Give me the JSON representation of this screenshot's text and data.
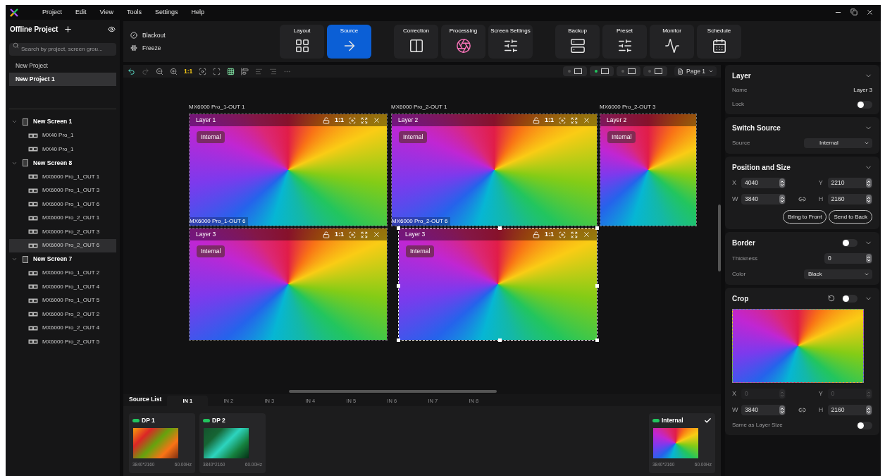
{
  "menu": [
    "Project",
    "Edit",
    "View",
    "Tools",
    "Settings",
    "Help"
  ],
  "sidebar": {
    "title": "Offline Project",
    "search": {
      "placeholder": "Search by project, screen grou..."
    },
    "projects": [
      {
        "label": "New Project",
        "selected": false
      },
      {
        "label": "New Project 1",
        "selected": true
      }
    ],
    "screens": [
      {
        "label": "New Screen 1",
        "expanded": true,
        "children": [
          {
            "label": "MX40 Pro_1",
            "selected": false
          },
          {
            "label": "MX40 Pro_1",
            "selected": false
          }
        ]
      },
      {
        "label": "New Screen 8",
        "expanded": true,
        "children": [
          {
            "label": "MX6000 Pro_1_OUT 1",
            "selected": false
          },
          {
            "label": "MX6000 Pro_1_OUT 3",
            "selected": false
          },
          {
            "label": "MX6000 Pro_1_OUT 6",
            "selected": false
          },
          {
            "label": "MX6000 Pro_2_OUT 1",
            "selected": false
          },
          {
            "label": "MX6000 Pro_2_OUT 3",
            "selected": false
          },
          {
            "label": "MX6000 Pro_2_OUT 6",
            "selected": true
          }
        ]
      },
      {
        "label": "New Screen 7",
        "expanded": true,
        "children": [
          {
            "label": "MX6000 Pro_1_OUT 2",
            "selected": false
          },
          {
            "label": "MX6000 Pro_1_OUT 4",
            "selected": false
          },
          {
            "label": "MX6000 Pro_1_OUT 5",
            "selected": false
          },
          {
            "label": "MX6000 Pro_2_OUT 2",
            "selected": false
          },
          {
            "label": "MX6000 Pro_2_OUT 4",
            "selected": false
          },
          {
            "label": "MX6000 Pro_2_OUT 5",
            "selected": false
          }
        ]
      }
    ]
  },
  "quick_actions": [
    {
      "kind": "blackout",
      "label": "Blackout"
    },
    {
      "kind": "freeze",
      "label": "Freeze"
    }
  ],
  "function_groups": [
    [
      {
        "kind": "layout",
        "label": "Layout",
        "selected": false
      },
      {
        "kind": "source",
        "label": "Source",
        "selected": true
      }
    ],
    [
      {
        "kind": "correction",
        "label": "Correction",
        "selected": false
      },
      {
        "kind": "processing",
        "label": "Processing",
        "selected": false
      },
      {
        "kind": "screen_settings",
        "label": "Screen Settings",
        "selected": false
      }
    ],
    [
      {
        "kind": "backup",
        "label": "Backup",
        "selected": false
      },
      {
        "kind": "preset",
        "label": "Preset",
        "selected": false
      },
      {
        "kind": "monitor",
        "label": "Monitor",
        "selected": false
      },
      {
        "kind": "schedule",
        "label": "Schedule",
        "selected": false
      }
    ]
  ],
  "canvas_toolbar": {
    "zoom_label": "1:1",
    "modes": [
      {
        "on": false
      },
      {
        "on": true
      },
      {
        "on": false
      },
      {
        "on": false
      }
    ],
    "page": "Page 1"
  },
  "canvas": {
    "screen_labels": [
      "MX6000 Pro_1-OUT 1",
      "MX6000 Pro_2-OUT 1",
      "MX6000 Pro_2-OUT 3"
    ],
    "layers": [
      {
        "name": "Layer 1",
        "tag": "Internal",
        "ratio": "1:1",
        "selected": false,
        "output_label": "MX6000 Pro_1-OUT 6"
      },
      {
        "name": "Layer 2",
        "tag": "Internal",
        "ratio": "1:1",
        "selected": false,
        "output_label": "MX6000 Pro_2-OUT 6"
      },
      {
        "name": "Layer 2",
        "tag": "Internal",
        "selected": false
      },
      {
        "name": "Layer 3",
        "tag": "Internal",
        "ratio": "1:1",
        "selected": false
      },
      {
        "name": "Layer 3",
        "tag": "Internal",
        "ratio": "1:1",
        "selected": true
      }
    ]
  },
  "source_list": {
    "title": "Source List",
    "tabs": [
      {
        "label": "IN 1",
        "selected": true
      },
      {
        "label": "IN 2",
        "selected": false
      },
      {
        "label": "IN 3",
        "selected": false
      },
      {
        "label": "IN 4",
        "selected": false
      },
      {
        "label": "IN 5",
        "selected": false
      },
      {
        "label": "IN 6",
        "selected": false
      },
      {
        "label": "IN 7",
        "selected": false
      },
      {
        "label": "IN 8",
        "selected": false
      }
    ],
    "sources": [
      {
        "kind": "fruit",
        "label": "DP 1",
        "resolution": "3840*2160",
        "rate": "60.00Hz",
        "selected": false
      },
      {
        "kind": "forest",
        "label": "DP 2",
        "resolution": "3840*2160",
        "rate": "60.00Hz",
        "selected": false
      },
      {
        "kind": "internal",
        "label": "Internal",
        "resolution": "3840*2160",
        "rate": "60.00Hz",
        "selected": true
      }
    ]
  },
  "properties": {
    "layer": {
      "title": "Layer",
      "name_label": "Name",
      "name_value": "Layer 3",
      "lock_label": "Lock",
      "lock_on": false
    },
    "switch_source": {
      "title": "Switch Source",
      "source_label": "Source",
      "source_value": "Internal"
    },
    "position": {
      "title": "Position and Size",
      "fields": [
        {
          "label": "X",
          "value": "4040"
        },
        {
          "label": "Y",
          "value": "2210"
        },
        {
          "label": "W",
          "value": "3840"
        },
        {
          "label": "H",
          "value": "2160"
        }
      ],
      "buttons": [
        "Bring to Front",
        "Send to Back"
      ]
    },
    "border": {
      "title": "Border",
      "on": false,
      "thickness_label": "Thickness",
      "thickness_value": "0",
      "color_label": "Color",
      "color_value": "Black"
    },
    "crop": {
      "title": "Crop",
      "on": false,
      "fields": [
        {
          "label": "X",
          "value": "0",
          "disabled": true
        },
        {
          "label": "Y",
          "value": "0",
          "disabled": true
        },
        {
          "label": "W",
          "value": "3840",
          "disabled": false
        },
        {
          "label": "H",
          "value": "2160",
          "disabled": false
        }
      ],
      "same_label": "Same as Layer Size",
      "same_on": false
    }
  }
}
